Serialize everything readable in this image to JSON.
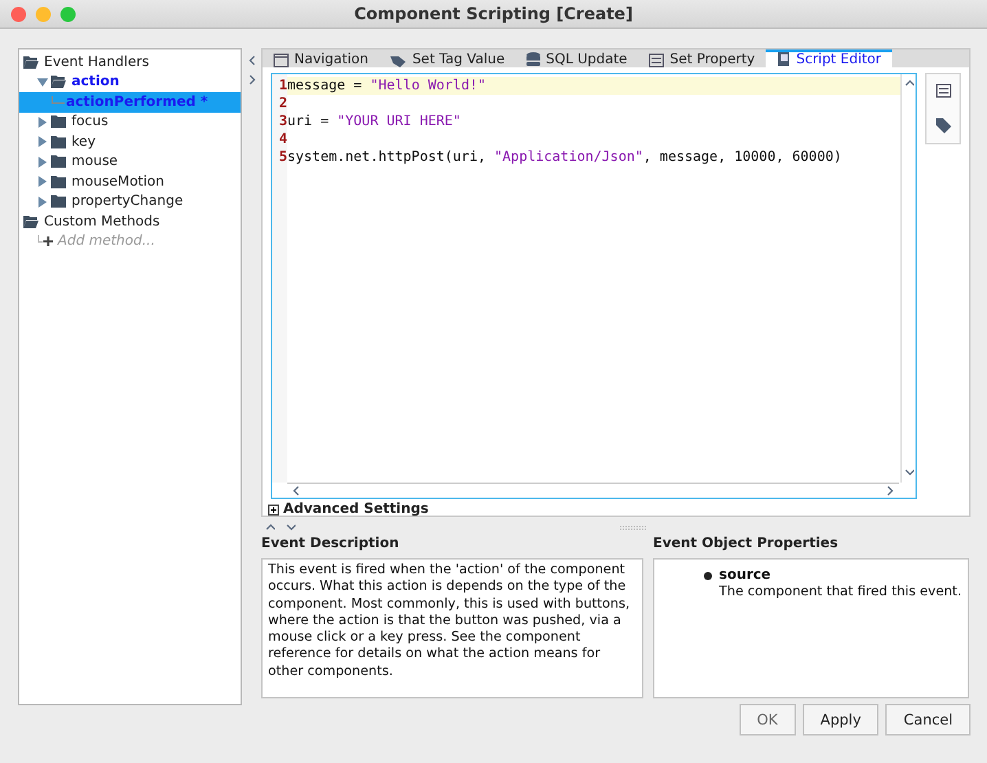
{
  "window": {
    "title": "Component Scripting [Create]"
  },
  "tree": [
    {
      "label": "Event Handlers",
      "kind": "folder",
      "expanded": true,
      "configured": false,
      "selected": false,
      "children": [
        {
          "label": "action",
          "kind": "folder",
          "expanded": true,
          "configured": true,
          "selected": false,
          "children": [
            {
              "label": "actionPerformed *",
              "kind": "leaf",
              "configured": true,
              "selected": true
            }
          ]
        },
        {
          "label": "focus",
          "kind": "folder",
          "expanded": false,
          "configured": false,
          "selected": false
        },
        {
          "label": "key",
          "kind": "folder",
          "expanded": false,
          "configured": false,
          "selected": false
        },
        {
          "label": "mouse",
          "kind": "folder",
          "expanded": false,
          "configured": false,
          "selected": false
        },
        {
          "label": "mouseMotion",
          "kind": "folder",
          "expanded": false,
          "configured": false,
          "selected": false
        },
        {
          "label": "propertyChange",
          "kind": "folder",
          "expanded": false,
          "configured": false,
          "selected": false
        }
      ]
    },
    {
      "label": "Custom Methods",
      "kind": "folder",
      "expanded": true,
      "configured": false,
      "selected": false,
      "children": [
        {
          "label": "Add method...",
          "kind": "add",
          "configured": false,
          "selected": false
        }
      ]
    }
  ],
  "tabs": [
    {
      "label": "Navigation",
      "selected": false
    },
    {
      "label": "Set Tag Value",
      "selected": false
    },
    {
      "label": "SQL Update",
      "selected": false
    },
    {
      "label": "Set Property",
      "selected": false
    },
    {
      "label": "Script Editor",
      "selected": true
    }
  ],
  "code": [
    {
      "number": "1",
      "current": true,
      "tokens": [
        {
          "text": "message = ",
          "kind": "plain"
        },
        {
          "text": "\"Hello World!\"",
          "kind": "string"
        }
      ]
    },
    {
      "number": "2",
      "current": false
    },
    {
      "number": "3",
      "current": false,
      "tokens": [
        {
          "text": "uri = ",
          "kind": "plain"
        },
        {
          "text": "\"YOUR URI HERE\"",
          "kind": "string"
        }
      ]
    },
    {
      "number": "4",
      "current": false
    },
    {
      "number": "5",
      "current": false,
      "tokens": [
        {
          "text": "system.net.httpPost(uri, ",
          "kind": "plain"
        },
        {
          "text": "\"Application/Json\"",
          "kind": "string"
        },
        {
          "text": ", message, 10000, 60000)",
          "kind": "plain"
        }
      ]
    }
  ],
  "advanced_settings": {
    "label": "Advanced Settings",
    "expanded": false
  },
  "event_description": {
    "title": "Event Description",
    "text": "This event is fired when the 'action' of the component occurs. What this action is depends on the type of the component. Most commonly, this is used with buttons, where the action is that the button was pushed, via a mouse click or a key press. See the component reference for details on what the action means for other components."
  },
  "event_object_properties": {
    "title": "Event Object Properties",
    "properties": [
      {
        "name": "source",
        "description": "The component that fired this event."
      }
    ]
  },
  "buttons": [
    {
      "label": "OK",
      "disabled": true
    },
    {
      "label": "Apply",
      "disabled": false
    },
    {
      "label": "Cancel",
      "disabled": false
    }
  ]
}
